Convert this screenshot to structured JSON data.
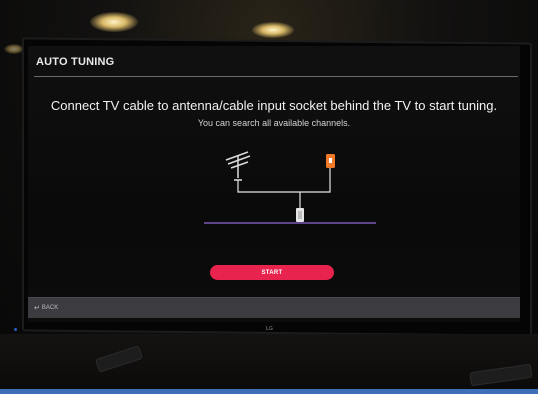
{
  "screen": {
    "title": "AUTO TUNING",
    "message": "Connect TV cable to antenna/cable input socket behind the TV to start tuning.",
    "submessage": "You can search all available channels.",
    "start_label": "START",
    "back_label": "BACK",
    "back_icon": "back-arrow-icon"
  },
  "branding": {
    "logo_text": "LG"
  },
  "colors": {
    "start_button": "#e8244e",
    "bottom_bar": "#3c3c40",
    "diagram_line": "#7a5bb5",
    "socket_orange": "#f07a2a"
  }
}
